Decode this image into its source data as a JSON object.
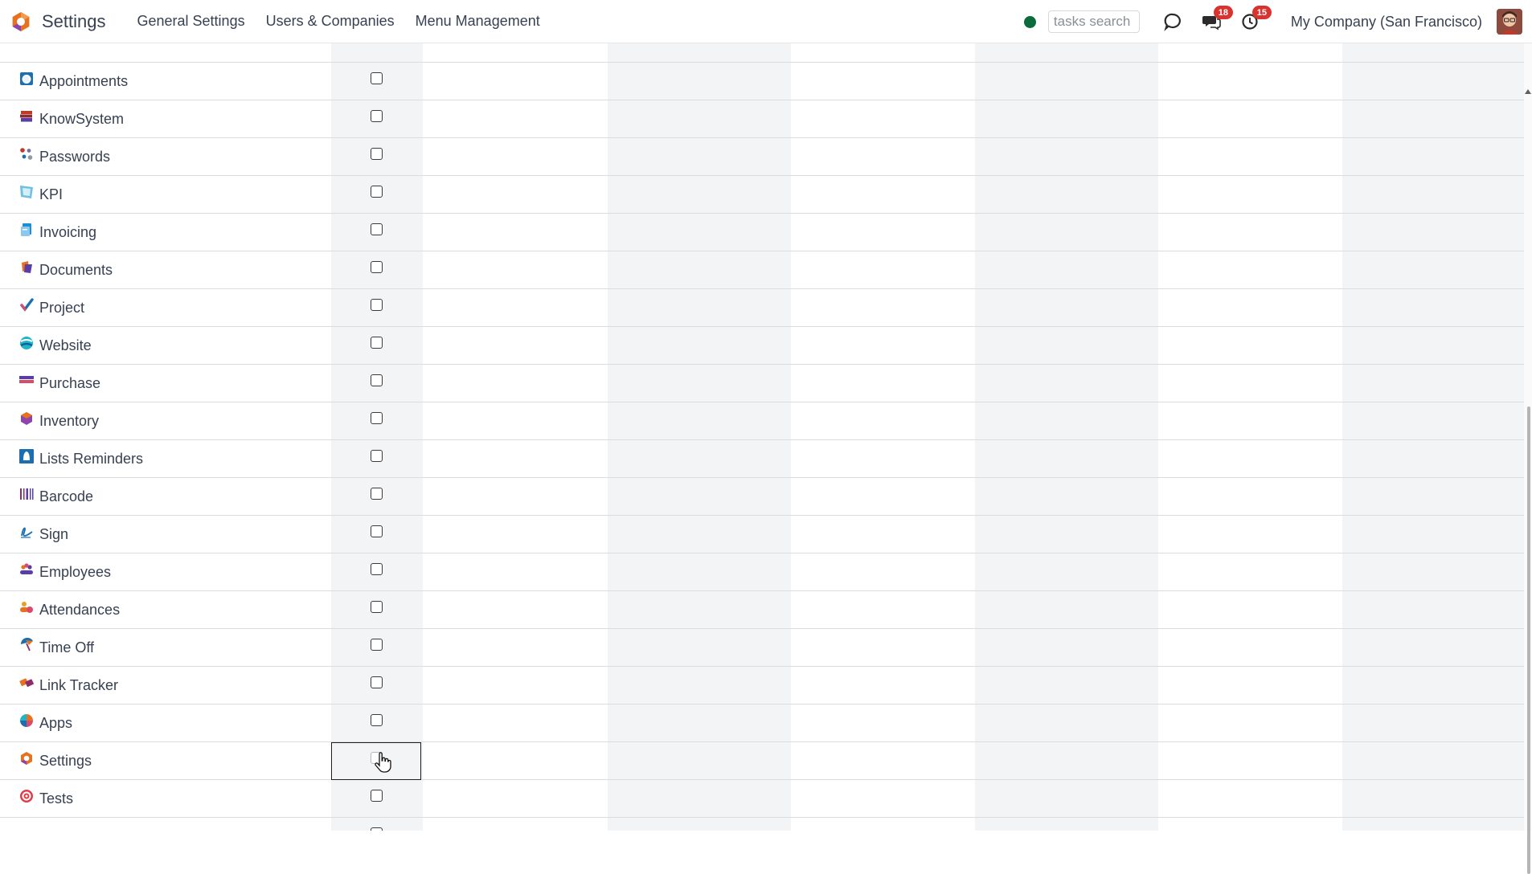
{
  "app": {
    "name": "Settings"
  },
  "nav": {
    "menu": [
      {
        "label": "General Settings"
      },
      {
        "label": "Users & Companies"
      },
      {
        "label": "Menu Management"
      }
    ],
    "search_placeholder": "tasks search",
    "messages_badge": "18",
    "activities_badge": "15",
    "company": "My Company (San Francisco)"
  },
  "rows": [
    {
      "label": "Appointments",
      "icon": "appointments-icon",
      "checked": false
    },
    {
      "label": "KnowSystem",
      "icon": "books-icon",
      "checked": false
    },
    {
      "label": "Passwords",
      "icon": "passwords-icon",
      "checked": false
    },
    {
      "label": "KPI",
      "icon": "kpi-icon",
      "checked": false
    },
    {
      "label": "Invoicing",
      "icon": "invoicing-icon",
      "checked": false
    },
    {
      "label": "Documents",
      "icon": "documents-icon",
      "checked": false
    },
    {
      "label": "Project",
      "icon": "project-check-icon",
      "checked": false
    },
    {
      "label": "Website",
      "icon": "website-globe-icon",
      "checked": false
    },
    {
      "label": "Purchase",
      "icon": "purchase-icon",
      "checked": false
    },
    {
      "label": "Inventory",
      "icon": "inventory-box-icon",
      "checked": false
    },
    {
      "label": "Lists Reminders",
      "icon": "bell-icon",
      "checked": false
    },
    {
      "label": "Barcode",
      "icon": "barcode-icon",
      "checked": false
    },
    {
      "label": "Sign",
      "icon": "signature-icon",
      "checked": false
    },
    {
      "label": "Employees",
      "icon": "employees-icon",
      "checked": false
    },
    {
      "label": "Attendances",
      "icon": "attendances-icon",
      "checked": false
    },
    {
      "label": "Time Off",
      "icon": "umbrella-icon",
      "checked": false
    },
    {
      "label": "Link Tracker",
      "icon": "link-tracker-icon",
      "checked": false
    },
    {
      "label": "Apps",
      "icon": "apps-icon",
      "checked": false
    },
    {
      "label": "Settings",
      "icon": "settings-icon",
      "checked": false,
      "focused": true
    },
    {
      "label": "Tests",
      "icon": "target-icon",
      "checked": false
    }
  ],
  "colors": {
    "brand": "#e8711e",
    "badge": "#d9332f",
    "presence": "#0b6b3a",
    "column_shade": "#f3f4f6"
  }
}
